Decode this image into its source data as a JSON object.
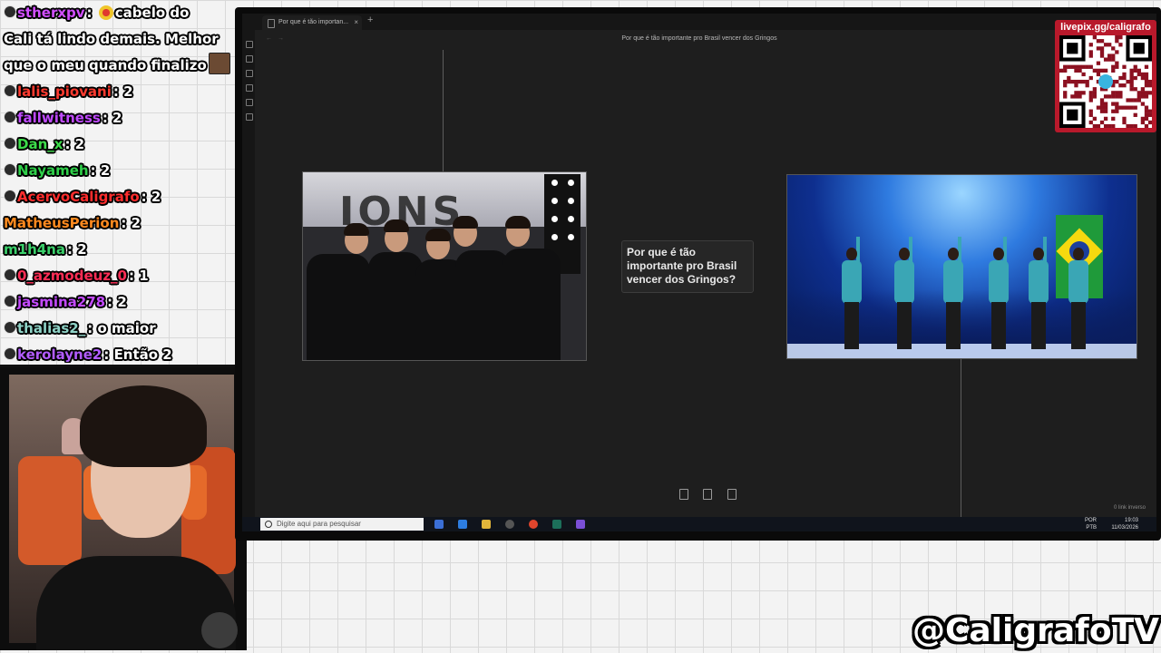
{
  "chat": {
    "messages": [
      {
        "user": "stherxpv",
        "color": "#d14fff",
        "text": "cabelo do",
        "badge": "emote"
      },
      {
        "user": "",
        "color": "#ffffff",
        "text": "Cali tá lindo demais. Melhor",
        "badge": "none"
      },
      {
        "user": "",
        "color": "#ffffff",
        "text": "que o meu quando finalizo",
        "badge": "none"
      },
      {
        "user": "lalis_piovani",
        "color": "#ff3b30",
        "text": "2",
        "badge": "dot"
      },
      {
        "user": "fallwitness",
        "color": "#c04bff",
        "text": "2",
        "badge": "dot"
      },
      {
        "user": "Dan_x",
        "color": "#3ddc4a",
        "text": "2",
        "badge": "dot"
      },
      {
        "user": "Nayameh",
        "color": "#2fd04a",
        "text": "2",
        "badge": "dot"
      },
      {
        "user": "AcervoCaligrafo",
        "color": "#ff2d2d",
        "text": "2",
        "badge": "dot"
      },
      {
        "user": "MatheusPerion",
        "color": "#ff8a1f",
        "text": "2",
        "badge": "none"
      },
      {
        "user": "m1h4na",
        "color": "#3bd06b",
        "text": "2",
        "badge": "none"
      },
      {
        "user": "0_azmodeuz_0",
        "color": "#ff2d55",
        "text": "1",
        "badge": "dot"
      },
      {
        "user": "jasmina278",
        "color": "#c44bff",
        "text": "2",
        "badge": "dot"
      },
      {
        "user": "thalias2_",
        "color": "#8fd3c7",
        "text": "o maior",
        "badge": "dot"
      },
      {
        "user": "kerolayne2",
        "color": "#b25cff",
        "text": "Então 2",
        "badge": "dot"
      }
    ]
  },
  "browser": {
    "tab_label": "Por que é tão importan...",
    "tab_close": "×",
    "new_tab": "+",
    "document_title": "Por que é tão importante pro Brasil vencer dos Gringos",
    "nav_back": "←",
    "nav_forward": "→"
  },
  "canvas": {
    "center_card_text": "Por que é tão importante pro Brasil vencer dos Gringos?",
    "left_banner_text": "IONS",
    "status_text": "0 link inverso"
  },
  "taskbar": {
    "search_placeholder": "Digite aqui para pesquisar",
    "lang": "POR",
    "lang_sub": "PTB",
    "time": "19:03",
    "date": "11/03/2026"
  },
  "qr": {
    "label": "livepix.gg/caligrafo"
  },
  "handle": "@CaligrafoTV",
  "colors": {
    "qr_bg": "#b8192b",
    "app_bg": "#1e1e1e",
    "flag_green": "#1f9a3a"
  }
}
